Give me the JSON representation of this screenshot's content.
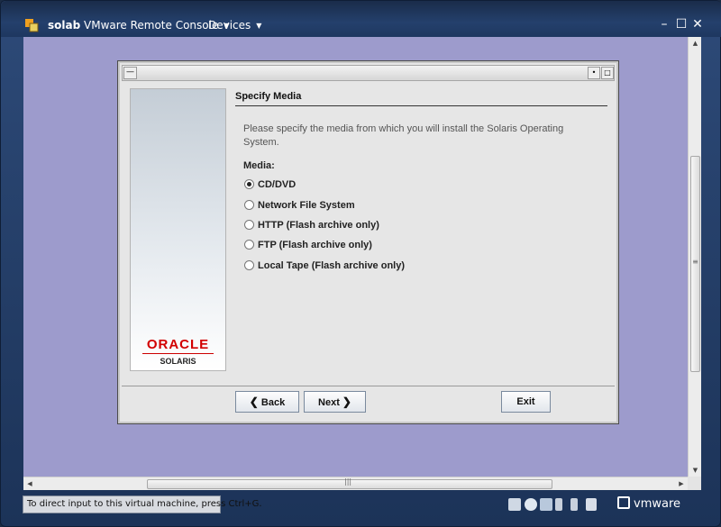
{
  "titlebar": {
    "vm_name": "solab",
    "app_menu": "VMware Remote Console",
    "devices_menu": "Devices",
    "minimize": "–",
    "maximize": "☐",
    "close": "✕"
  },
  "installer": {
    "heading": "Specify Media",
    "description": "Please specify the media from which you will install the Solaris Operating System.",
    "media_label": "Media:",
    "options": [
      {
        "label": "CD/DVD",
        "selected": true
      },
      {
        "label": "Network File System",
        "selected": false
      },
      {
        "label": "HTTP (Flash archive only)",
        "selected": false
      },
      {
        "label": "FTP (Flash archive only)",
        "selected": false
      },
      {
        "label": "Local Tape (Flash archive only)",
        "selected": false
      }
    ],
    "buttons": {
      "back": "Back",
      "next": "Next",
      "exit": "Exit"
    },
    "logo": {
      "oracle": "ORACLE",
      "solaris": "SOLARIS"
    }
  },
  "statusbar": {
    "hint": "To direct input to this virtual machine, press Ctrl+G.",
    "brand": "vmware"
  },
  "colors": {
    "console_background": "#9d9bcc",
    "oracle_red": "#d20000",
    "window_frame": "#24406c"
  }
}
